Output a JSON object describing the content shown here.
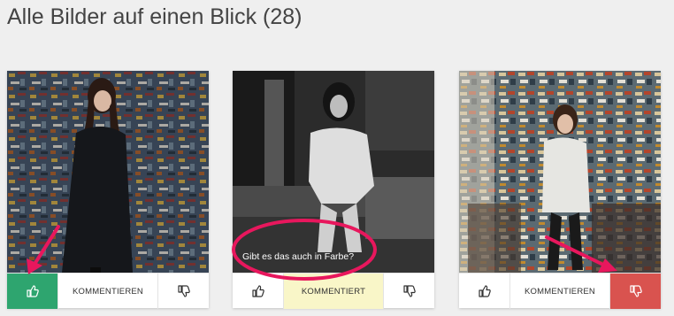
{
  "page": {
    "title": "Alle Bilder auf einen Blick (28)"
  },
  "colors": {
    "like_active": "#2ea56f",
    "dislike_active": "#d9534f",
    "comment_active": "#f9f6c8",
    "annotation": "#e8175d"
  },
  "cards": [
    {
      "photo": "woman-in-black-coat-graffiti-wall",
      "comment_label": "KOMMENTIEREN",
      "liked": true,
      "disliked": false,
      "commented": false
    },
    {
      "photo": "woman-seated-black-and-white",
      "comment_label": "KOMMENTIERT",
      "liked": false,
      "disliked": false,
      "commented": true,
      "comment_preview": "Gibt es das auch in Farbe?"
    },
    {
      "photo": "woman-in-artist-studio",
      "comment_label": "KOMMENTIEREN",
      "liked": false,
      "disliked": true,
      "commented": false
    }
  ],
  "icons": {
    "like": "thumbs-up-icon",
    "dislike": "thumbs-down-icon"
  }
}
